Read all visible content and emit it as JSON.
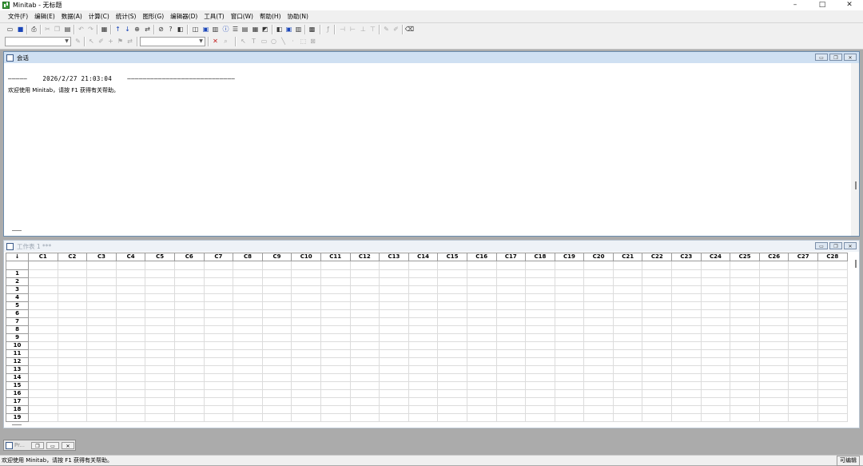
{
  "window": {
    "title": "Minitab - 无标题",
    "controls": {
      "minimize": "–",
      "maximize": "□",
      "close": "✕"
    }
  },
  "menubar": {
    "items": [
      "文件(F)",
      "编辑(E)",
      "数据(A)",
      "计算(C)",
      "统计(S)",
      "图形(G)",
      "编辑器(D)",
      "工具(T)",
      "窗口(W)",
      "帮助(H)",
      "协助(N)"
    ]
  },
  "session": {
    "title": "会话",
    "line1": "—————    2026/2/27 21:03:04    ————————————————————————————",
    "line2": "欢迎使用 Minitab，请按 F1 获得有关帮助。"
  },
  "worksheet": {
    "title": "工作表 1 ***",
    "corner": "↓",
    "columns": [
      "C1",
      "C2",
      "C3",
      "C4",
      "C5",
      "C6",
      "C7",
      "C8",
      "C9",
      "C10",
      "C11",
      "C12",
      "C13",
      "C14",
      "C15",
      "C16",
      "C17",
      "C18",
      "C19",
      "C20",
      "C21",
      "C22",
      "C23",
      "C24",
      "C25",
      "C26",
      "C27",
      "C28"
    ],
    "rows": [
      "1",
      "2",
      "3",
      "4",
      "5",
      "6",
      "7",
      "8",
      "9",
      "10",
      "11",
      "12",
      "13",
      "14",
      "15",
      "16",
      "17",
      "18",
      "19"
    ]
  },
  "minimized": {
    "label": "Pr..."
  },
  "statusbar": {
    "text": "欢迎使用 Minitab，请按 F1 获得有关帮助。",
    "mode": "可编辑"
  }
}
